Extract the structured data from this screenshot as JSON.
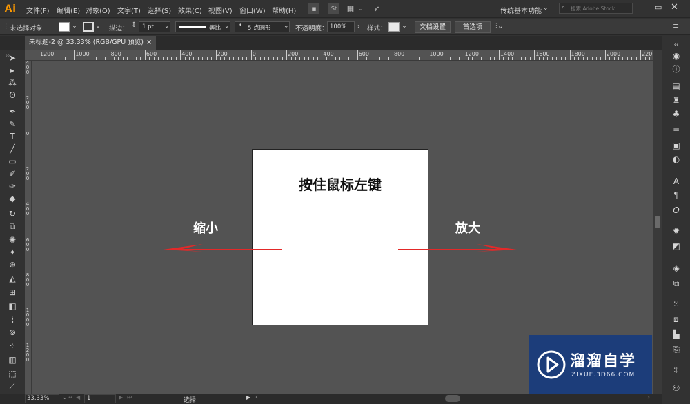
{
  "app": {
    "logo": "Ai"
  },
  "menu": [
    "文件(F)",
    "编辑(E)",
    "对象(O)",
    "文字(T)",
    "选择(S)",
    "效果(C)",
    "视图(V)",
    "窗口(W)",
    "帮助(H)"
  ],
  "toolbar_right": {
    "workspace": "传统基本功能",
    "search_placeholder": "搜索 Adobe Stock"
  },
  "control": {
    "no_selection": "未选择对象",
    "stroke_label": "描边：",
    "stroke_value": "1 pt",
    "stroke_profile": "等比",
    "brush": "5 点圆形",
    "opacity_label": "不透明度：",
    "opacity_value": "100%",
    "style_label": "样式：",
    "doc_setup": "文档设置",
    "prefs": "首选项"
  },
  "document_tab": {
    "title": "未标题-2 @ 33.33% (RGB/GPU 预览)",
    "close": "×"
  },
  "ruler_h": [
    "1200",
    "1000",
    "800",
    "600",
    "400",
    "200",
    "0",
    "200",
    "400",
    "600",
    "800",
    "1000",
    "1200",
    "1400",
    "1600",
    "1800",
    "2000",
    "2200"
  ],
  "ruler_v": [
    "4 0 0",
    "2 0 0",
    "0",
    "2 0 0",
    "4 0 0",
    "6 0 0",
    "8 0 0",
    "1 0 0 0",
    "1 2 0 0"
  ],
  "artboard_text": "按住鼠标左键",
  "left_label": "缩小",
  "right_label": "放大",
  "arrow_color": "#e32929",
  "status": {
    "zoom": "33.33%",
    "page": "1",
    "tool": "选择"
  },
  "watermark": {
    "title": "溜溜自学",
    "url": "ZIXUE.3D66.COM"
  }
}
